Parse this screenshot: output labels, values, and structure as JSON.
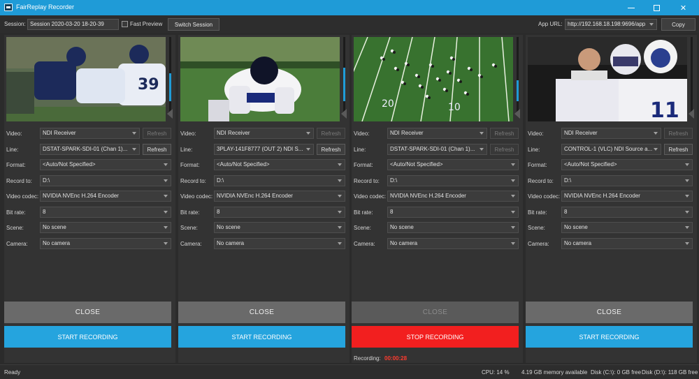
{
  "window": {
    "title": "FairReplay Recorder",
    "controls": {
      "minimize_icon": "minimize-icon",
      "maximize_icon": "maximize-icon",
      "close_glyph": "✕"
    }
  },
  "sessionbar": {
    "session_label": "Session:",
    "session_value": "Session 2020-03-20 18-20-39",
    "fast_preview_label": "Fast Preview",
    "switch_session_label": "Switch Session",
    "app_url_label": "App URL:",
    "app_url_value": "http://192.168.18.198:9696/app",
    "copy_label": "Copy"
  },
  "labels": {
    "video": "Video:",
    "line": "Line:",
    "format": "Format:",
    "record_to": "Record to:",
    "video_codec": "Video codec:",
    "bit_rate": "Bit rate:",
    "scene": "Scene:",
    "camera": "Camera:",
    "refresh": "Refresh",
    "close": "CLOSE"
  },
  "panels": [
    {
      "video": "NDI Receiver",
      "line": "DSTAT-SPARK-SDI-01 (Chan 1)...",
      "format": "<Auto/Not Specified>",
      "record_to": "D:\\",
      "codec": "NVIDIA NVEnc H.264 Encoder",
      "bitrate": "8",
      "scene": "No scene",
      "camera": "No camera",
      "record_label": "START RECORDING",
      "recording": false,
      "preview": "football-tackle"
    },
    {
      "video": "NDI Receiver",
      "line": "3PLAY-141F8777 (OUT 2) NDI S...",
      "format": "<Auto/Not Specified>",
      "record_to": "D:\\",
      "codec": "NVIDIA NVEnc H.264 Encoder",
      "bitrate": "8",
      "scene": "No scene",
      "camera": "No camera",
      "record_label": "START RECORDING",
      "recording": false,
      "preview": "kneeling-player"
    },
    {
      "video": "NDI Receiver",
      "line": "DSTAT-SPARK-SDI-01 (Chan 1)...",
      "format": "<Auto/Not Specified>",
      "record_to": "D:\\",
      "codec": "NVIDIA NVEnc H.264 Encoder",
      "bitrate": "8",
      "scene": "No scene",
      "camera": "No camera",
      "record_label": "STOP RECORDING",
      "recording": true,
      "recording_label": "Recording:",
      "recording_time": "00:00:28",
      "preview": "field-overhead"
    },
    {
      "video": "NDI Receiver",
      "line": "CONTROL-1 (VLC) NDI Source a...",
      "format": "<Auto/Not Specified>",
      "record_to": "D:\\",
      "codec": "NVIDIA NVEnc H.264 Encoder",
      "bitrate": "8",
      "scene": "No scene",
      "camera": "No camera",
      "record_label": "START RECORDING",
      "recording": false,
      "preview": "referee-player"
    }
  ],
  "statusbar": {
    "ready": "Ready",
    "cpu": "CPU:   14 %",
    "memory": "4.19 GB memory available",
    "disk_c": "Disk (C:\\): 0 GB free",
    "disk_d": "Disk (D:\\): 118 GB free"
  },
  "colors": {
    "accent": "#1f9bd7",
    "start_recording": "#25a4de",
    "stop_recording": "#f21f1f",
    "recording_time": "#ff3b2f"
  }
}
